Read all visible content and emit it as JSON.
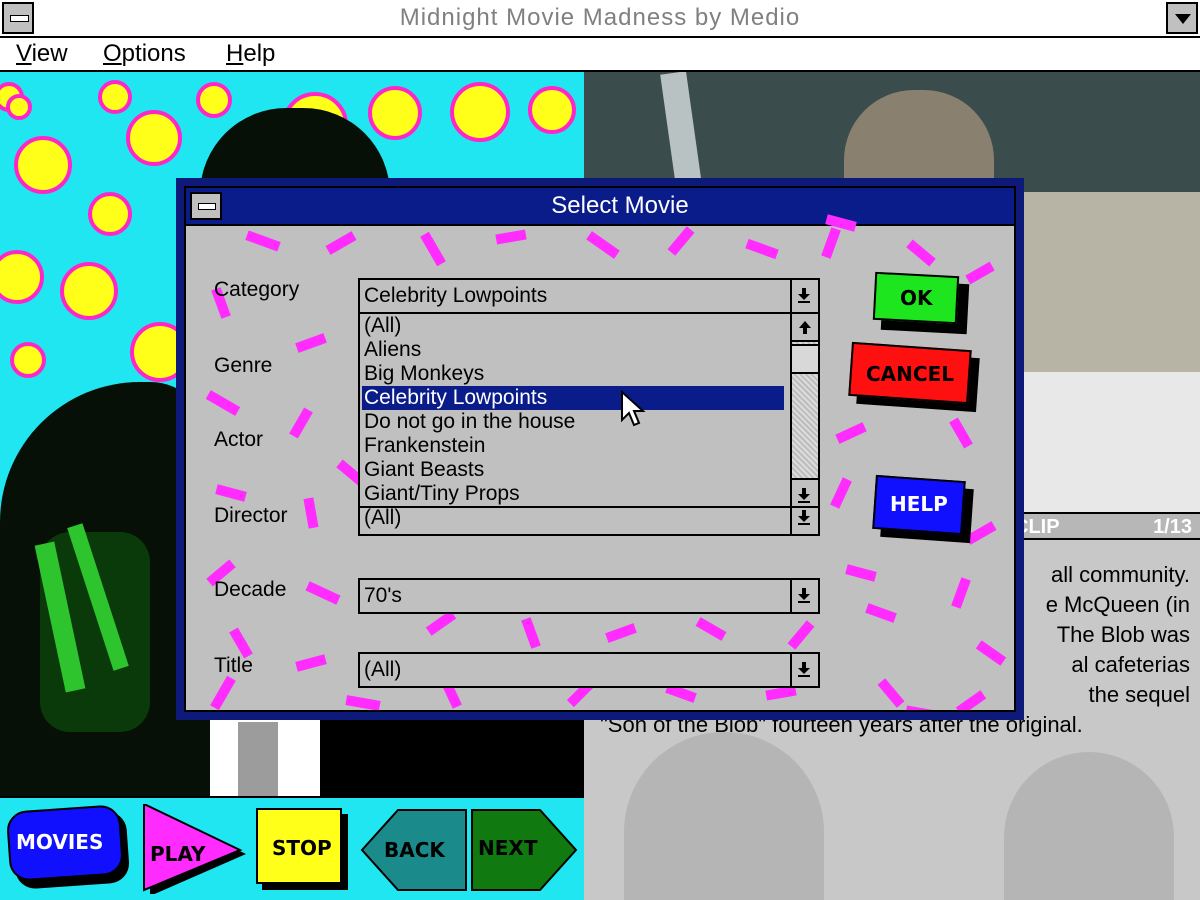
{
  "app": {
    "title": "Midnight Movie Madness by Medio"
  },
  "menu": {
    "items": [
      "View",
      "Options",
      "Help"
    ]
  },
  "clip": {
    "label": "CLIP",
    "count": "1/13"
  },
  "description": {
    "lines": [
      "all community.",
      "e McQueen (in",
      "The Blob was",
      "al cafeterias",
      "the sequel",
      "\"Son of the Blob\" fourteen years after the original."
    ]
  },
  "toolbar": {
    "movies": "MOVIES",
    "play": "PLAY",
    "stop": "STOP",
    "back": "BACK",
    "next": "NEXT"
  },
  "dialog": {
    "title": "Select Movie",
    "labels": {
      "category": "Category",
      "genre": "Genre",
      "actor": "Actor",
      "director": "Director",
      "decade": "Decade",
      "title": "Title"
    },
    "category_value": "Celebrity Lowpoints",
    "category_options": [
      "(All)",
      "Aliens",
      "Big Monkeys",
      "Celebrity Lowpoints",
      "Do not go in the house",
      "Frankenstein",
      "Giant Beasts",
      "Giant/Tiny Props"
    ],
    "selected_index": 3,
    "director_value": "(All)",
    "decade_value": "70's",
    "title_value": "(All)",
    "buttons": {
      "ok": "OK",
      "cancel": "CANCEL",
      "help": "HELP"
    }
  },
  "colors": {
    "cyan_background": "#1fe6f0",
    "dot_yellow": "#ffff1a",
    "dot_magenta": "#ff26c8",
    "confetti": "#ff2bff",
    "dialog_blue": "#0a1c8a",
    "ok_green": "#1ee61e",
    "cancel_red": "#ff1010",
    "help_blue": "#1010ff"
  }
}
